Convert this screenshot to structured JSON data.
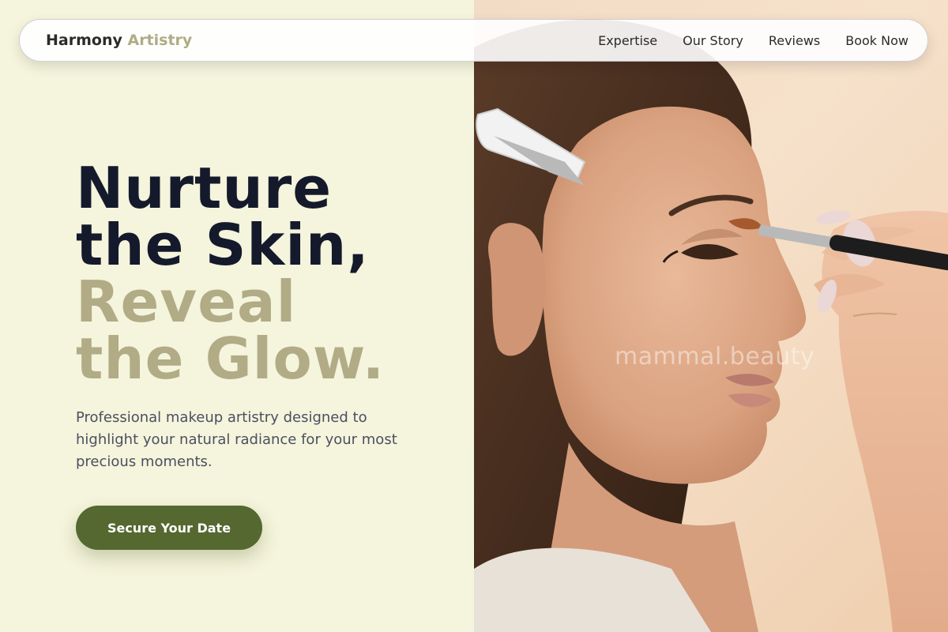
{
  "brand": {
    "name": "Harmony",
    "accent": "Artistry"
  },
  "nav": {
    "links": [
      {
        "label": "Expertise"
      },
      {
        "label": "Our Story"
      },
      {
        "label": "Reviews"
      },
      {
        "label": "Book Now"
      }
    ]
  },
  "hero": {
    "line1": "Nurture",
    "line2": "the Skin,",
    "line3": "Reveal",
    "line4": "the Glow.",
    "subtitle": "Professional makeup artistry designed to highlight your natural radiance for your most precious moments.",
    "cta_label": "Secure Your Date"
  },
  "photo": {
    "watermark": "mammal.beauty"
  },
  "colors": {
    "background": "#f5f4dc",
    "heading_dark": "#141a2b",
    "heading_muted": "#b1ab86",
    "cta": "#556830",
    "brand_accent": "#b1ab86"
  }
}
